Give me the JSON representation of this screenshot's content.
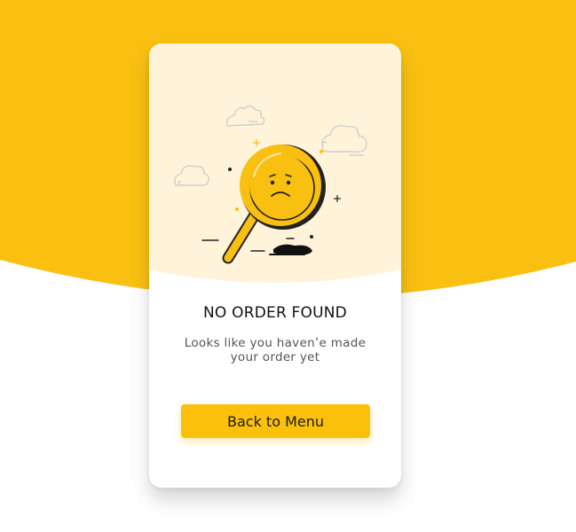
{
  "colors": {
    "brand_yellow": "#f9c012",
    "card_top_cream": "#fff4d9",
    "button_yellow": "#fbc10a",
    "title_color": "#111111",
    "subtitle_color": "#555555"
  },
  "empty_state": {
    "title": "NO ORDER FOUND",
    "message": "Looks like you haven’e made your order yet",
    "illustration_icon": "sad-magnifying-glass-icon"
  },
  "actions": {
    "back_label": "Back to Menu"
  }
}
